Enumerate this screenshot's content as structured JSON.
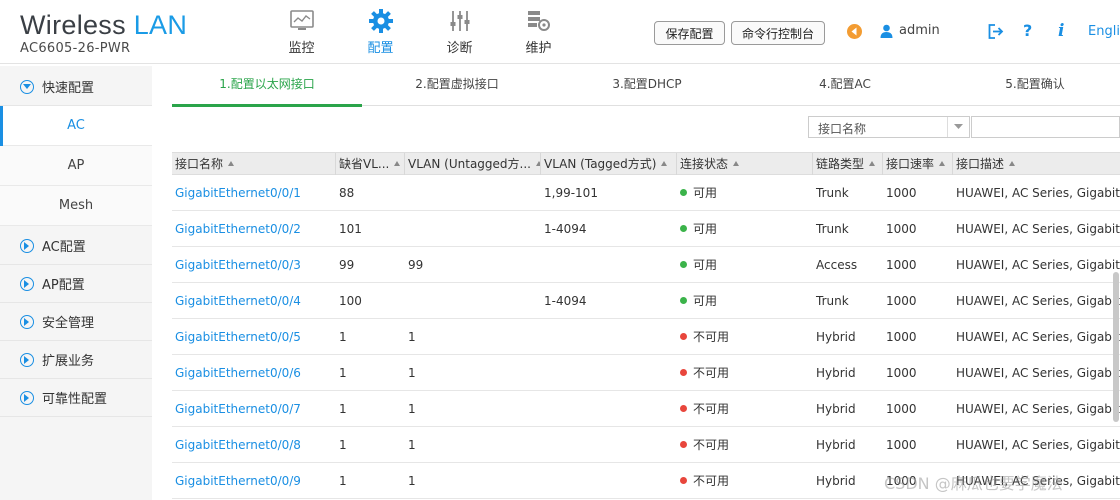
{
  "brand": {
    "title_main": "Wireless",
    "title_accent": "LAN",
    "model": "AC6605-26-PWR"
  },
  "topnav": [
    {
      "label": "监控",
      "icon": "monitor-icon"
    },
    {
      "label": "配置",
      "icon": "gear-icon",
      "active": true
    },
    {
      "label": "诊断",
      "icon": "sliders-icon"
    },
    {
      "label": "维护",
      "icon": "maintenance-icon"
    }
  ],
  "header": {
    "save_config": "保存配置",
    "cli_console": "命令行控制台",
    "user": "admin",
    "language": "English"
  },
  "sidebar": {
    "quick": "快速配置",
    "sub": [
      "AC",
      "AP",
      "Mesh"
    ],
    "groups": [
      "AC配置",
      "AP配置",
      "安全管理",
      "扩展业务",
      "可靠性配置"
    ]
  },
  "wizard": {
    "steps": [
      "1.配置以太网接口",
      "2.配置虚拟接口",
      "3.配置DHCP",
      "4.配置AC",
      "5.配置确认"
    ],
    "active_index": 0
  },
  "filter": {
    "field": "接口名称"
  },
  "table": {
    "columns": [
      "接口名称",
      "缺省VL...",
      "VLAN (Untagged方...",
      "VLAN (Tagged方式)",
      "连接状态",
      "链路类型",
      "接口速率",
      "接口描述"
    ],
    "rows": [
      [
        "GigabitEthernet0/0/1",
        "88",
        "",
        "1,99-101",
        "可用",
        "Trunk",
        "1000",
        "HUAWEI, AC Series, GigabitEt"
      ],
      [
        "GigabitEthernet0/0/2",
        "101",
        "",
        "1-4094",
        "可用",
        "Trunk",
        "1000",
        "HUAWEI, AC Series, GigabitEt"
      ],
      [
        "GigabitEthernet0/0/3",
        "99",
        "99",
        "",
        "可用",
        "Access",
        "1000",
        "HUAWEI, AC Series, GigabitEt"
      ],
      [
        "GigabitEthernet0/0/4",
        "100",
        "",
        "1-4094",
        "可用",
        "Trunk",
        "1000",
        "HUAWEI, AC Series, GigabitEt"
      ],
      [
        "GigabitEthernet0/0/5",
        "1",
        "1",
        "",
        "不可用",
        "Hybrid",
        "1000",
        "HUAWEI, AC Series, GigabitEt"
      ],
      [
        "GigabitEthernet0/0/6",
        "1",
        "1",
        "",
        "不可用",
        "Hybrid",
        "1000",
        "HUAWEI, AC Series, GigabitEt"
      ],
      [
        "GigabitEthernet0/0/7",
        "1",
        "1",
        "",
        "不可用",
        "Hybrid",
        "1000",
        "HUAWEI, AC Series, GigabitEt"
      ],
      [
        "GigabitEthernet0/0/8",
        "1",
        "1",
        "",
        "不可用",
        "Hybrid",
        "1000",
        "HUAWEI, AC Series, GigabitEt"
      ],
      [
        "GigabitEthernet0/0/9",
        "1",
        "1",
        "",
        "不可用",
        "Hybrid",
        "1000",
        "HUAWEI, AC Series, GigabitEt"
      ]
    ]
  },
  "watermark": "CSDN @麻瓜也要学魔法",
  "colors": {
    "accent": "#1a8fe3",
    "active_step": "#2aa44a",
    "status_ok": "#3bb34a",
    "status_bad": "#e8463c"
  }
}
